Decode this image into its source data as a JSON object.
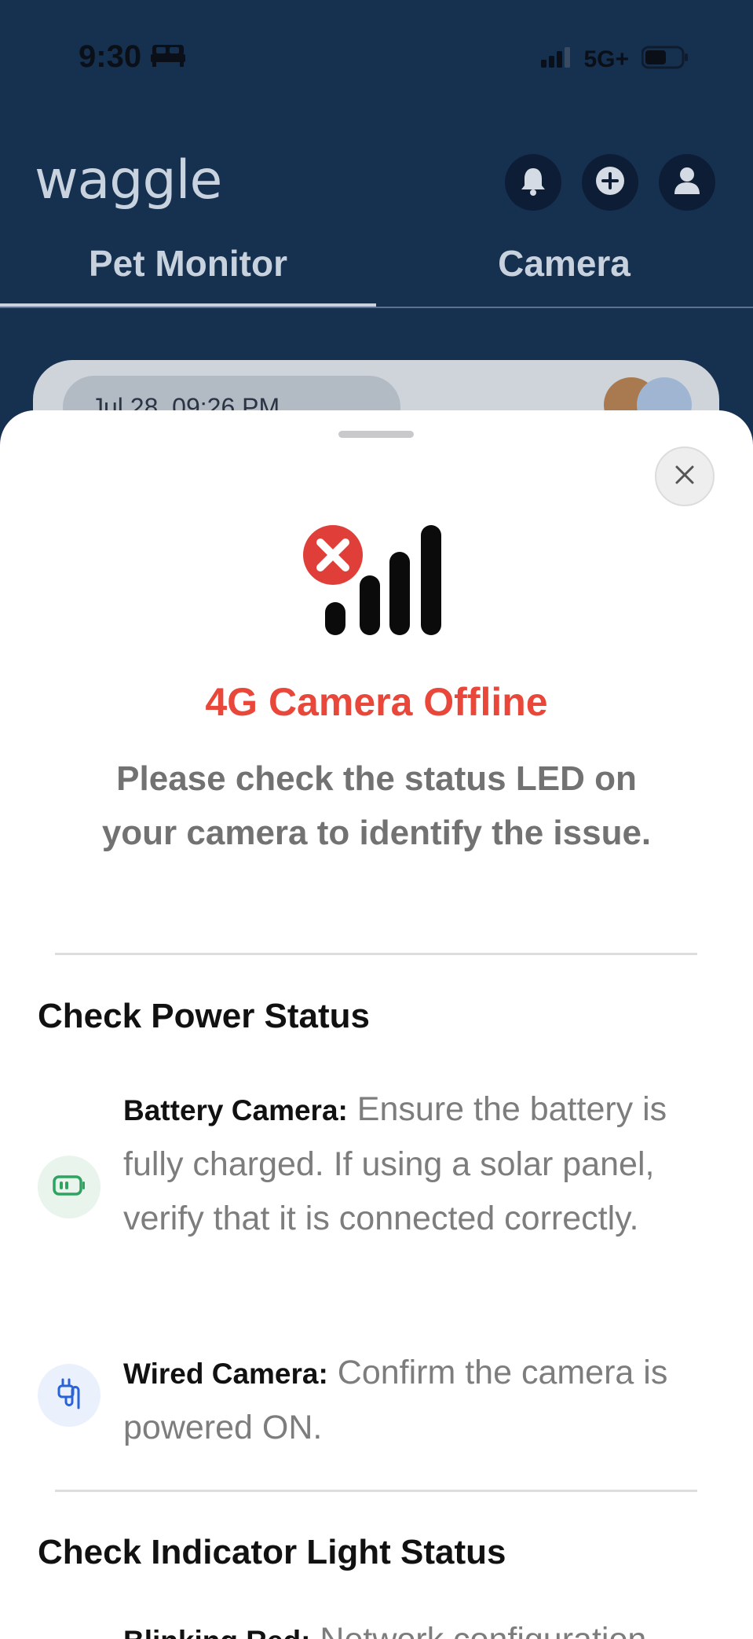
{
  "status_bar": {
    "time": "9:30",
    "network": "5G+"
  },
  "header": {
    "logo": "waggle",
    "tabs": [
      {
        "label": "Pet Monitor",
        "active": true
      },
      {
        "label": "Camera",
        "active": false
      }
    ]
  },
  "background_card": {
    "timestamp_partial": "Jul 28, 09:26 PM"
  },
  "sheet": {
    "title": "4G Camera Offline",
    "subtitle": "Please check the status LED on your camera to identify the issue.",
    "sections": [
      {
        "heading": "Check Power Status",
        "items": [
          {
            "label": "Battery Camera:",
            "text": " Ensure the battery is fully charged. If using a solar panel, verify that it is connected correctly.",
            "icon": "battery-icon"
          },
          {
            "label": "Wired Camera:",
            "text": " Confirm the camera is powered ON.",
            "icon": "plug-icon"
          }
        ]
      },
      {
        "heading": "Check Indicator Light Status",
        "items": [
          {
            "label": "Blinking Red:",
            "text": " Network configuration",
            "icon": ""
          }
        ]
      }
    ]
  },
  "colors": {
    "header_bg": "#16304f",
    "title_red": "#e8473a",
    "battery_green": "#2fa361",
    "plug_blue": "#2a63d8"
  }
}
